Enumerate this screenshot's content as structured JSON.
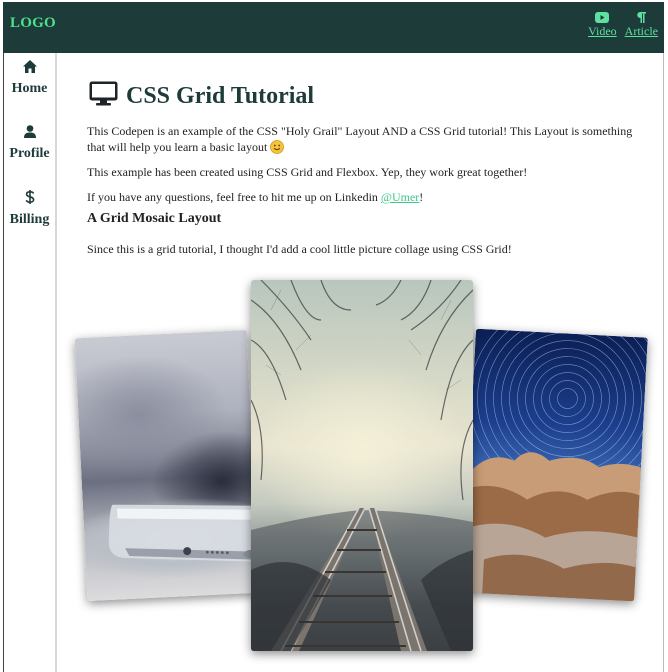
{
  "header": {
    "logo": "LOGO",
    "nav": [
      {
        "label": "Video",
        "icon": "youtube-icon"
      },
      {
        "label": "Article",
        "icon": "paragraph-icon"
      }
    ]
  },
  "sidebar": {
    "items": [
      {
        "label": "Home",
        "icon": "home-icon"
      },
      {
        "label": "Profile",
        "icon": "user-icon"
      },
      {
        "label": "Billing",
        "icon": "dollar-icon"
      }
    ]
  },
  "main": {
    "title": "CSS Grid Tutorial",
    "title_icon": "monitor-icon",
    "paragraph1": "This Codepen is an example of the CSS \"Holy Grail\" Layout AND a CSS Grid tutorial! This Layout is something that will help you learn a basic layout",
    "paragraph2": "This example has been created using CSS Grid and Flexbox. Yep, they work great together!",
    "paragraph3_prefix": "If you have any questions, feel free to hit me up on Linkedin ",
    "paragraph3_link": "@Umer",
    "paragraph3_suffix": "!",
    "subheading": "A Grid Mosaic Layout",
    "paragraph4": "Since this is a grid tutorial, I thought I'd add a cool little picture collage using CSS Grid!"
  },
  "gallery": {
    "images": [
      "phone-photo",
      "forest-railway-photo",
      "star-trails-photo"
    ]
  },
  "colors": {
    "header_bg": "#1d3b39",
    "accent": "#4fe08f",
    "title": "#1d3b39"
  }
}
